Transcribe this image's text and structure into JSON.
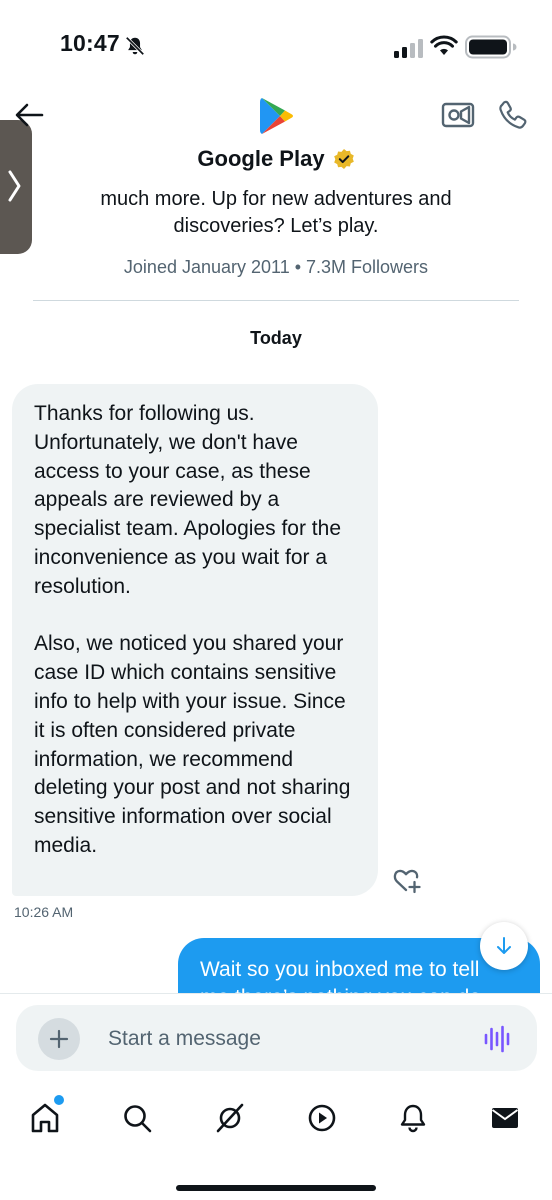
{
  "status_bar": {
    "time": "10:47"
  },
  "header": {
    "title": "Google Play",
    "bio_line1": "much more. Up for new adventures and",
    "bio_line2": "discoveries? Let’s play.",
    "joined": "Joined January 2011 • 7.3M Followers"
  },
  "conversation": {
    "date_label": "Today",
    "incoming": {
      "paragraph1": "Thanks for following us. Unfortunately, we don't have access to your case, as these appeals are reviewed by a specialist team. Apologies for the inconvenience as you wait for a resolution.",
      "paragraph2": "Also, we noticed you shared your case ID which contains sensitive info to help with your issue. Since it is often considered private information, we recommend deleting your post and not sharing sensitive information over social media.",
      "time": "10:26 AM"
    },
    "outgoing": {
      "line1": "Wait so you inboxed me to tell",
      "line2": "me there’s nothing you can do"
    }
  },
  "composer": {
    "placeholder": "Start a message"
  },
  "colors": {
    "accent": "#1d9bf0",
    "bubble_in": "#eff3f4",
    "verified": "#e8b829",
    "voice": "#7856ff"
  },
  "icons": [
    "back-arrow-icon",
    "google-play-logo",
    "verified-badge-icon",
    "video-call-icon",
    "phone-call-icon",
    "add-reaction-icon",
    "scroll-down-icon",
    "plus-icon",
    "voice-message-icon",
    "home-icon",
    "search-icon",
    "grok-icon",
    "video-icon",
    "notifications-icon",
    "messages-icon"
  ]
}
